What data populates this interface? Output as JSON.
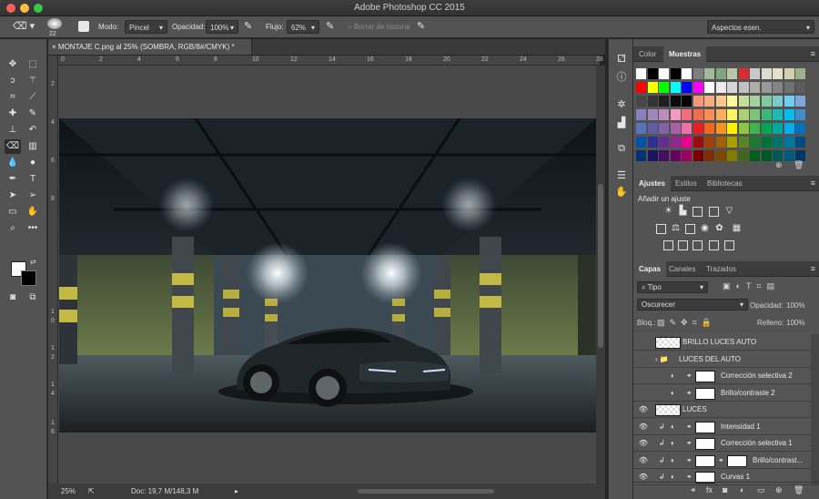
{
  "window": {
    "title": "Adobe Photoshop CC 2015"
  },
  "options": {
    "brush_size": "22",
    "mode_label": "Modo:",
    "mode_value": "Pincel",
    "opacity_label": "Opacidad:",
    "opacity_value": "100%",
    "flow_label": "Flujo:",
    "flow_value": "62%",
    "history_label": "Borrar de historia",
    "workspace": "Aspectos esen."
  },
  "document": {
    "tab_title": "MONTAJE C.png al 25% (SOMBRA, RGB/8#/CMYK) *",
    "ruler_top": [
      "0",
      "2",
      "4",
      "6",
      "8",
      "10",
      "12",
      "14",
      "16",
      "18",
      "20",
      "22",
      "24",
      "26",
      "28"
    ],
    "ruler_left": [
      "2",
      "4",
      "6",
      "8",
      "1",
      "0",
      "1",
      "2",
      "1",
      "4",
      "1",
      "6"
    ],
    "zoom": "25%",
    "doc_info": "Doc: 19,7 M/148,3 M"
  },
  "color_panel": {
    "tabs": [
      "Color",
      "Muestras"
    ],
    "active": "Muestras"
  },
  "adjust_panel": {
    "tabs": [
      "Ajustes",
      "Estilos",
      "Bibliotecas"
    ],
    "heading": "Añadir un ajuste"
  },
  "layers_panel": {
    "tabs": [
      "Capas",
      "Canales",
      "Trazados"
    ],
    "filter": "Tipo",
    "blend_mode": "Oscurecer",
    "opacity_label": "Opacidad:",
    "opacity_value": "100%",
    "lock_label": "Bloq.:",
    "fill_label": "Relleno:",
    "fill_value": "100%",
    "layers": [
      {
        "name": "BRILLO LUCES AUTO"
      },
      {
        "name": "LUCES DEL AUTO"
      },
      {
        "name": "Corrección selectiva 2"
      },
      {
        "name": "Brillo/contraste 2"
      },
      {
        "name": "LUCES"
      },
      {
        "name": "Intensidad 1"
      },
      {
        "name": "Corrección selectiva 1"
      },
      {
        "name": "Brillo/contrast..."
      },
      {
        "name": "Curvas 1"
      }
    ]
  },
  "colors": {
    "accent_blue": "#2f5b9a",
    "panel_bg": "#535353",
    "canvas_bg": "#494949"
  }
}
